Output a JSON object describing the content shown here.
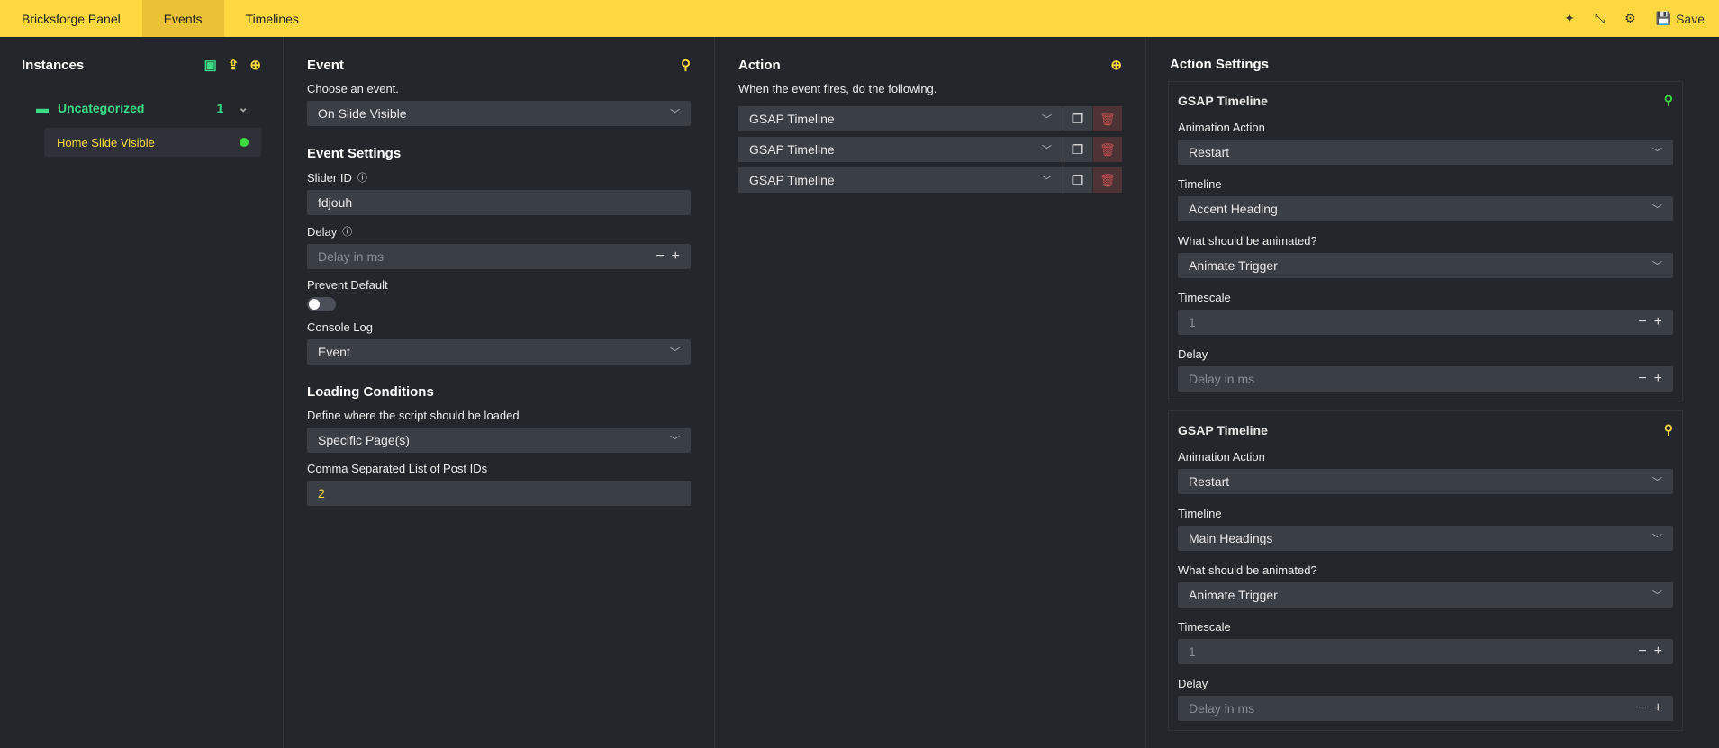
{
  "topbar": {
    "brand": "Bricksforge Panel",
    "tabs": [
      "Events",
      "Timelines"
    ],
    "save_label": "Save"
  },
  "instances": {
    "title": "Instances",
    "folder": {
      "name": "Uncategorized",
      "count": "1"
    },
    "items": [
      {
        "label": "Home Slide Visible",
        "status_color": "#3ddc3d"
      }
    ]
  },
  "event": {
    "title": "Event",
    "choose_label": "Choose an event.",
    "choose_value": "On Slide Visible",
    "settings_title": "Event Settings",
    "slider_id_label": "Slider ID",
    "slider_id_value": "fdjouh",
    "delay_label": "Delay",
    "delay_placeholder": "Delay in ms",
    "prevent_default_label": "Prevent Default",
    "console_log_label": "Console Log",
    "console_log_value": "Event",
    "loading_title": "Loading Conditions",
    "define_label": "Define where the script should be loaded",
    "define_value": "Specific Page(s)",
    "post_ids_label": "Comma Separated List of Post IDs",
    "post_ids_value": "2"
  },
  "action": {
    "title": "Action",
    "desc": "When the event fires, do the following.",
    "rows": [
      "GSAP Timeline",
      "GSAP Timeline",
      "GSAP Timeline"
    ]
  },
  "action_settings": {
    "title": "Action Settings",
    "cards": [
      {
        "title": "GSAP Timeline",
        "animation_action_label": "Animation Action",
        "animation_action": "Restart",
        "timeline_label": "Timeline",
        "timeline": "Accent Heading",
        "animate_label": "What should be animated?",
        "animate": "Animate Trigger",
        "timescale_label": "Timescale",
        "timescale": "1",
        "delay_label": "Delay",
        "delay_placeholder": "Delay in ms"
      },
      {
        "title": "GSAP Timeline",
        "animation_action_label": "Animation Action",
        "animation_action": "Restart",
        "timeline_label": "Timeline",
        "timeline": "Main Headings",
        "animate_label": "What should be animated?",
        "animate": "Animate Trigger",
        "timescale_label": "Timescale",
        "timescale": "1",
        "delay_label": "Delay",
        "delay_placeholder": "Delay in ms"
      }
    ]
  }
}
